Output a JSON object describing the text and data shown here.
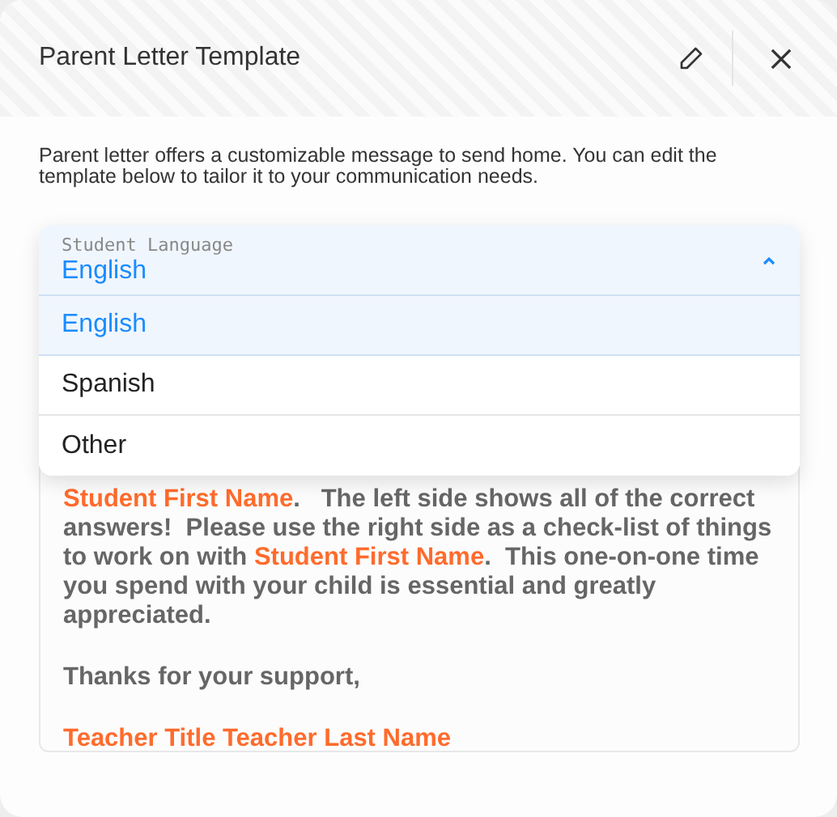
{
  "dialog": {
    "title": "Parent Letter Template",
    "description": "Parent letter offers a customizable message to send home. You can edit the template below to tailor it to your communication needs."
  },
  "language_select": {
    "label": "Student Language",
    "value": "English",
    "expanded": true,
    "options": [
      {
        "label": "English",
        "selected": true
      },
      {
        "label": "Spanish",
        "selected": false
      },
      {
        "label": "Other",
        "selected": false
      }
    ]
  },
  "letter": {
    "paragraphs": [
      [
        {
          "kind": "field",
          "text": "Student First Name"
        },
        {
          "kind": "text",
          "text": ".   The left side shows all of the correct answers!  Please use the right side as a check-list of things to work on with "
        },
        {
          "kind": "field",
          "text": "Student First Name"
        },
        {
          "kind": "text",
          "text": ".  This one-on-one time you spend with your child is essential and greatly appreciated."
        }
      ],
      [
        {
          "kind": "text",
          "text": "Thanks for your support,"
        }
      ],
      [
        {
          "kind": "field",
          "text": "Teacher Title Teacher Last Name"
        }
      ]
    ]
  }
}
